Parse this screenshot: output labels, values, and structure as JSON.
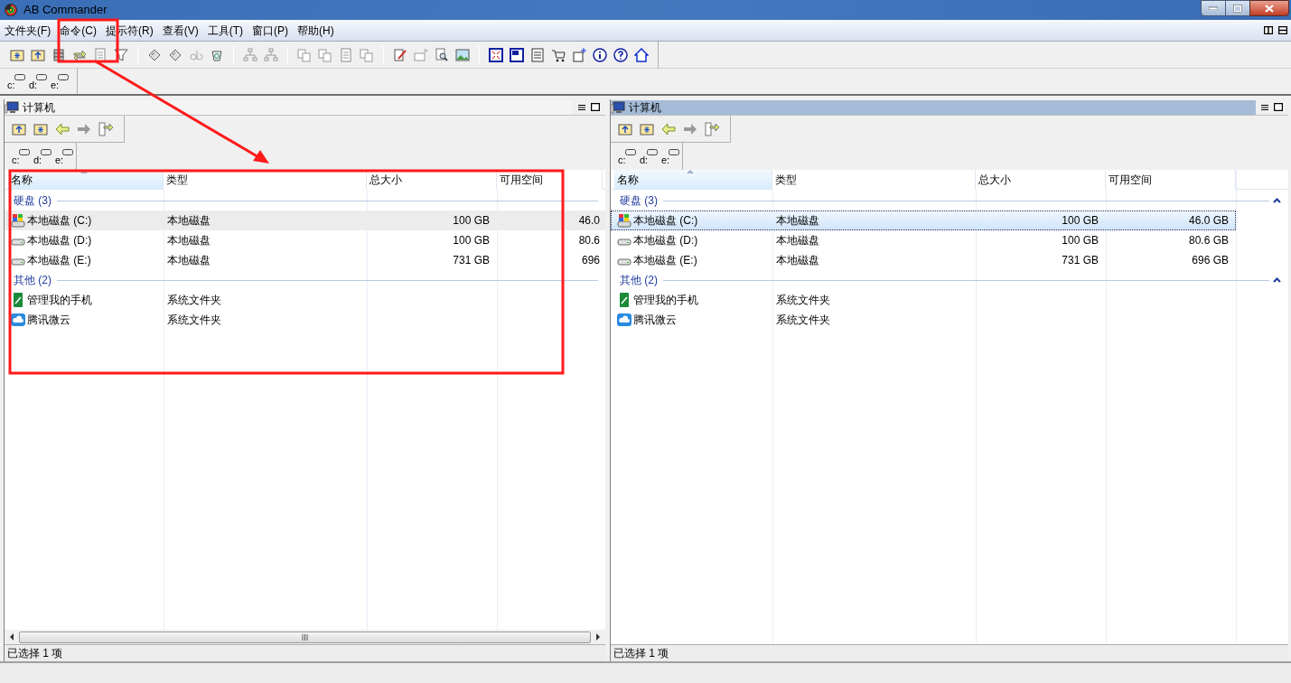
{
  "window": {
    "title": "AB Commander"
  },
  "menu": [
    "文件夹(F)",
    "命令(C)",
    "提示符(R)",
    "查看(V)",
    "工具(T)",
    "窗口(P)",
    "帮助(H)"
  ],
  "drives": [
    "c:",
    "d:",
    "e:"
  ],
  "panes": [
    {
      "title": "计算机",
      "active": false,
      "horizontal_scrollbar": true,
      "drives": [
        "c:",
        "d:",
        "e:"
      ],
      "columns": [
        "名称",
        "类型",
        "总大小",
        "可用空间"
      ],
      "groups": [
        {
          "label": "硬盘 (3)",
          "rows": [
            {
              "kind": "system-drive",
              "name": "本地磁盘 (C:)",
              "type": "本地磁盘",
              "total": "100 GB",
              "free": "46.0",
              "selected": true
            },
            {
              "kind": "drive",
              "name": "本地磁盘 (D:)",
              "type": "本地磁盘",
              "total": "100 GB",
              "free": "80.6",
              "selected": false
            },
            {
              "kind": "drive",
              "name": "本地磁盘 (E:)",
              "type": "本地磁盘",
              "total": "731 GB",
              "free": "696",
              "selected": false
            }
          ]
        },
        {
          "label": "其他 (2)",
          "rows": [
            {
              "kind": "phone",
              "name": "管理我的手机",
              "type": "系统文件夹",
              "selected": false
            },
            {
              "kind": "cloud",
              "name": "腾讯微云",
              "type": "系统文件夹",
              "selected": false
            }
          ]
        }
      ],
      "status": "已选择 1 项"
    },
    {
      "title": "计算机",
      "active": true,
      "horizontal_scrollbar": false,
      "drives": [
        "c:",
        "d:",
        "e:"
      ],
      "columns": [
        "名称",
        "类型",
        "总大小",
        "可用空间"
      ],
      "groups": [
        {
          "label": "硬盘 (3)",
          "rows": [
            {
              "kind": "system-drive",
              "name": "本地磁盘 (C:)",
              "type": "本地磁盘",
              "total": "100 GB",
              "free": "46.0 GB",
              "selected": true
            },
            {
              "kind": "drive",
              "name": "本地磁盘 (D:)",
              "type": "本地磁盘",
              "total": "100 GB",
              "free": "80.6 GB",
              "selected": false
            },
            {
              "kind": "drive",
              "name": "本地磁盘 (E:)",
              "type": "本地磁盘",
              "total": "731 GB",
              "free": "696 GB",
              "selected": false
            }
          ]
        },
        {
          "label": "其他 (2)",
          "rows": [
            {
              "kind": "phone",
              "name": "管理我的手机",
              "type": "系统文件夹",
              "selected": false
            },
            {
              "kind": "cloud",
              "name": "腾讯微云",
              "type": "系统文件夹",
              "selected": false
            }
          ]
        }
      ],
      "status": "已选择 1 项"
    }
  ]
}
